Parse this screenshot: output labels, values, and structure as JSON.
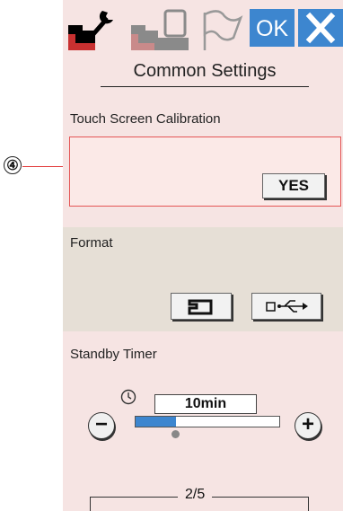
{
  "callout": {
    "number": "④"
  },
  "header": {
    "ok_label": "OK",
    "close_symbol": "✕",
    "title": "Common Settings"
  },
  "calibration": {
    "label": "Touch Screen Calibration",
    "button": "YES"
  },
  "format": {
    "label": "Format"
  },
  "standby": {
    "label": "Standby Timer",
    "value": "10min",
    "minus": "−",
    "plus": "+",
    "slider_fraction": 0.28
  },
  "pagination": {
    "text": "2/5"
  },
  "colors": {
    "panel_bg": "#f6e4e3",
    "format_bg": "#e6dfd6",
    "accent_blue": "#3d86cf",
    "highlight_red": "#e45555"
  },
  "icons": {
    "tab_1": "sewing-machine-wrench-icon",
    "tab_2": "embroidery-machine-icon",
    "tab_3": "flag-icon",
    "format_1": "sewing-machine-icon",
    "format_2": "usb-icon",
    "timer": "clock-icon"
  }
}
